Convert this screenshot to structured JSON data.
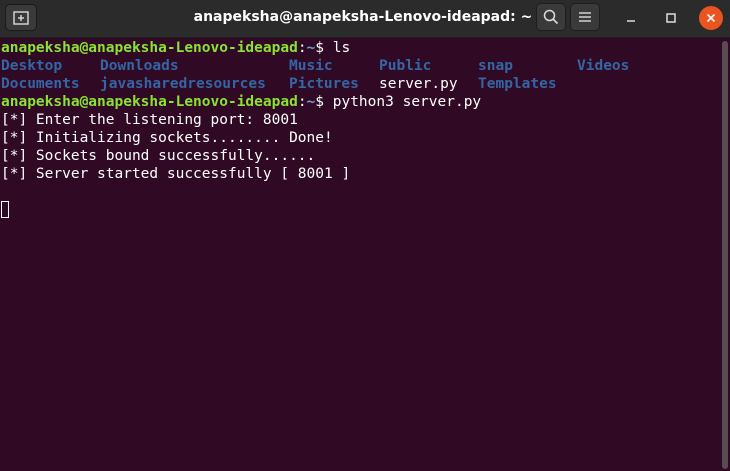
{
  "window": {
    "title": "anapeksha@anapeksha-Lenovo-ideapad: ~",
    "icons": {
      "new_tab": "new-tab-icon",
      "search": "search-icon",
      "menu": "hamburger-menu-icon",
      "minimize": "minimize-icon",
      "maximize": "maximize-icon",
      "close": "close-icon"
    },
    "accent_color": "#e95420"
  },
  "terminal": {
    "colors": {
      "background": "#300a24",
      "prompt_user": "#8ae234",
      "prompt_path": "#729fcf",
      "directory": "#3465a4",
      "text": "#ffffff"
    },
    "prompt": {
      "user_host": "anapeksha@anapeksha-Lenovo-ideapad",
      "colon": ":",
      "path": "~",
      "symbol": "$"
    },
    "commands": {
      "ls": " ls",
      "python": " python3 server.py"
    },
    "ls_row1": [
      "Desktop",
      "Downloads",
      "Music",
      "Public",
      "snap",
      "Videos"
    ],
    "ls_row2": [
      "Documents",
      "javasharedresources",
      "Pictures",
      "server.py",
      "Templates"
    ],
    "output": [
      "[*] Enter the listening port: 8001",
      "[*] Initializing sockets........ Done!",
      "[*] Sockets bound successfully......",
      "[*] Server started successfully [ 8001 ]"
    ]
  }
}
